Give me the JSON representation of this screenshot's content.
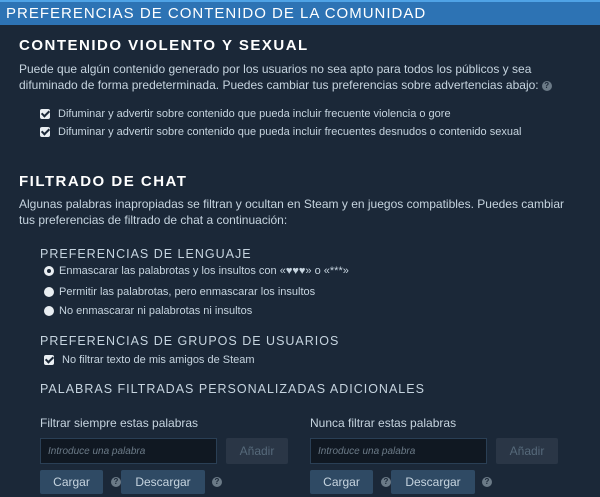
{
  "header": {
    "title": "PREFERENCIAS DE CONTENIDO DE LA COMUNIDAD"
  },
  "violent": {
    "title": "CONTENIDO VIOLENTO Y SEXUAL",
    "description": "Puede que algún contenido generado por los usuarios no sea apto para todos los públicos y sea difuminado de forma predeterminada. Puedes cambiar tus preferencias sobre advertencias abajo:",
    "help_icon": "?",
    "options": [
      {
        "label": "Difuminar y advertir sobre contenido que pueda incluir frecuente violencia o gore",
        "checked": true
      },
      {
        "label": "Difuminar y advertir sobre contenido que pueda incluir frecuentes desnudos o contenido sexual",
        "checked": true
      }
    ]
  },
  "chat": {
    "title": "FILTRADO DE CHAT",
    "description": "Algunas palabras inapropiadas se filtran y ocultan en Steam y en juegos compatibles. Puedes cambiar tus preferencias de filtrado de chat a continuación:",
    "language": {
      "title": "PREFERENCIAS DE LENGUAJE",
      "options": [
        {
          "label": "Enmascarar las palabrotas y los insultos con «♥♥♥» o «***»",
          "selected": true
        },
        {
          "label": "Permitir las palabrotas, pero enmascarar los insultos",
          "selected": false
        },
        {
          "label": "No enmascarar ni palabrotas ni insultos",
          "selected": false
        }
      ]
    },
    "groups": {
      "title": "PREFERENCIAS DE GRUPOS DE USUARIOS",
      "option": {
        "label": "No filtrar texto de mis amigos de Steam",
        "checked": true
      }
    },
    "custom": {
      "title": "PALABRAS FILTRADAS PERSONALIZADAS ADICIONALES",
      "always": {
        "label": "Filtrar siempre estas palabras",
        "placeholder": "Introduce una palabra",
        "add_label": "Añadir",
        "load_label": "Cargar",
        "download_label": "Descargar"
      },
      "never": {
        "label": "Nunca filtrar estas palabras",
        "placeholder": "Introduce una palabra",
        "add_label": "Añadir",
        "load_label": "Cargar",
        "download_label": "Descargar"
      },
      "help_icon": "?"
    }
  },
  "colors": {
    "background": "#1b2838",
    "header": "#2d73b4",
    "text": "#c6d4df"
  }
}
